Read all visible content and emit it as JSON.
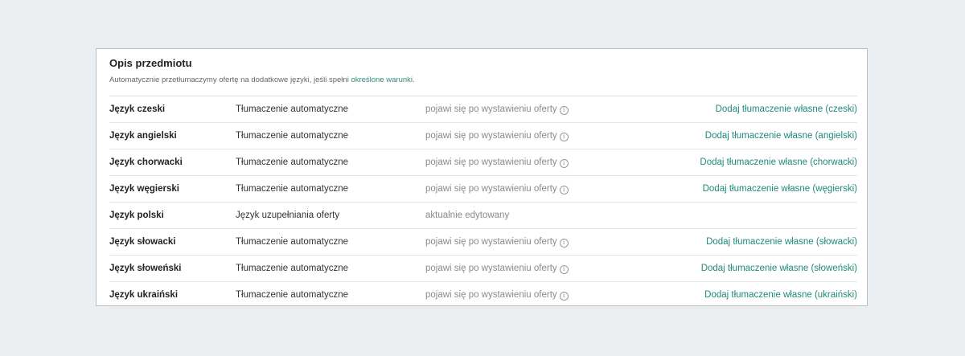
{
  "section": {
    "title": "Opis przedmiotu",
    "subtitle_prefix": "Automatycznie przetłumaczymy ofertę na dodatkowe języki, jeśli spełni ",
    "subtitle_link": "określone warunki",
    "subtitle_suffix": "."
  },
  "colors": {
    "accent": "#1f8a78",
    "border": "#bdbdbd",
    "background": "#eceff1"
  },
  "rows": [
    {
      "language": "Język czeski",
      "type": "Tłumaczenie automatyczne",
      "status": "pojawi się po wystawieniu oferty",
      "info_icon": "info-icon",
      "action": "Dodaj tłumaczenie własne (czeski)"
    },
    {
      "language": "Język angielski",
      "type": "Tłumaczenie automatyczne",
      "status": "pojawi się po wystawieniu oferty",
      "info_icon": "info-icon",
      "action": "Dodaj tłumaczenie własne (angielski)"
    },
    {
      "language": "Język chorwacki",
      "type": "Tłumaczenie automatyczne",
      "status": "pojawi się po wystawieniu oferty",
      "info_icon": "info-icon",
      "action": "Dodaj tłumaczenie własne (chorwacki)"
    },
    {
      "language": "Język węgierski",
      "type": "Tłumaczenie automatyczne",
      "status": "pojawi się po wystawieniu oferty",
      "info_icon": "info-icon",
      "action": "Dodaj tłumaczenie własne (węgierski)"
    },
    {
      "language": "Język polski",
      "type": "Język uzupełniania oferty",
      "status": "aktualnie edytowany",
      "info_icon": "",
      "action": ""
    },
    {
      "language": "Język słowacki",
      "type": "Tłumaczenie automatyczne",
      "status": "pojawi się po wystawieniu oferty",
      "info_icon": "info-icon",
      "action": "Dodaj tłumaczenie własne (słowacki)"
    },
    {
      "language": "Język słoweński",
      "type": "Tłumaczenie automatyczne",
      "status": "pojawi się po wystawieniu oferty",
      "info_icon": "info-icon",
      "action": "Dodaj tłumaczenie własne (słoweński)"
    },
    {
      "language": "Język ukraiński",
      "type": "Tłumaczenie automatyczne",
      "status": "pojawi się po wystawieniu oferty",
      "info_icon": "info-icon",
      "action": "Dodaj tłumaczenie własne (ukraiński)"
    }
  ]
}
